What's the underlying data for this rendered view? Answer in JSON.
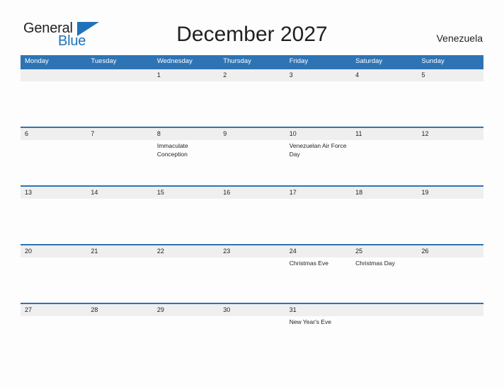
{
  "brand": {
    "name_part1": "General",
    "name_part2": "Blue",
    "triangle_icon": "triangle-icon",
    "accent_color": "#1f72b8"
  },
  "header": {
    "title": "December 2027",
    "region": "Venezuela"
  },
  "calendar": {
    "header_color": "#2e74b5",
    "date_band_color": "#efefef",
    "weekdays": [
      "Monday",
      "Tuesday",
      "Wednesday",
      "Thursday",
      "Friday",
      "Saturday",
      "Sunday"
    ],
    "weeks": [
      [
        {
          "day": "",
          "event": ""
        },
        {
          "day": "",
          "event": ""
        },
        {
          "day": "1",
          "event": ""
        },
        {
          "day": "2",
          "event": ""
        },
        {
          "day": "3",
          "event": ""
        },
        {
          "day": "4",
          "event": ""
        },
        {
          "day": "5",
          "event": ""
        }
      ],
      [
        {
          "day": "6",
          "event": ""
        },
        {
          "day": "7",
          "event": ""
        },
        {
          "day": "8",
          "event": "Immaculate Conception"
        },
        {
          "day": "9",
          "event": ""
        },
        {
          "day": "10",
          "event": "Venezuelan Air Force Day"
        },
        {
          "day": "11",
          "event": ""
        },
        {
          "day": "12",
          "event": ""
        }
      ],
      [
        {
          "day": "13",
          "event": ""
        },
        {
          "day": "14",
          "event": ""
        },
        {
          "day": "15",
          "event": ""
        },
        {
          "day": "16",
          "event": ""
        },
        {
          "day": "17",
          "event": ""
        },
        {
          "day": "18",
          "event": ""
        },
        {
          "day": "19",
          "event": ""
        }
      ],
      [
        {
          "day": "20",
          "event": ""
        },
        {
          "day": "21",
          "event": ""
        },
        {
          "day": "22",
          "event": ""
        },
        {
          "day": "23",
          "event": ""
        },
        {
          "day": "24",
          "event": "Christmas Eve"
        },
        {
          "day": "25",
          "event": "Christmas Day"
        },
        {
          "day": "26",
          "event": ""
        }
      ],
      [
        {
          "day": "27",
          "event": ""
        },
        {
          "day": "28",
          "event": ""
        },
        {
          "day": "29",
          "event": ""
        },
        {
          "day": "30",
          "event": ""
        },
        {
          "day": "31",
          "event": "New Year's Eve"
        },
        {
          "day": "",
          "event": ""
        },
        {
          "day": "",
          "event": ""
        }
      ]
    ]
  }
}
